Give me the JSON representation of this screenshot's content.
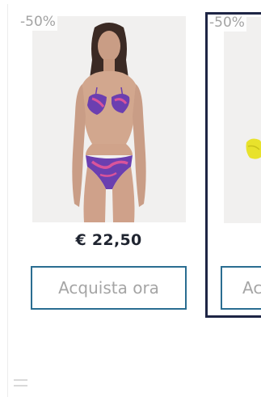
{
  "products": [
    {
      "discount": "-50%",
      "price": "€ 22,50",
      "button_label": "Acquista ora",
      "image_alt": "model-bikini-purple-pink-swirl-icon"
    },
    {
      "discount": "-50%",
      "button_label": "Acquista ora",
      "image_alt": "yellow-swimwear-product-icon"
    }
  ],
  "colors": {
    "accent_button_border": "#2a6d91",
    "selected_card_border": "#1e2545",
    "price_text": "#1f2430",
    "badge_text": "#a3a3a3"
  }
}
